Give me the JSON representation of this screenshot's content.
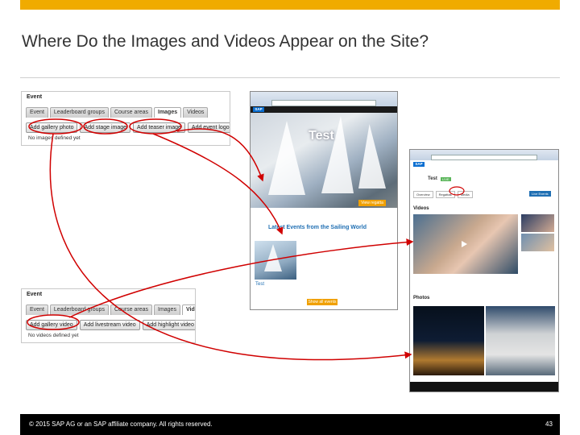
{
  "slide": {
    "title": "Where Do the Images and Videos Appear on the Site?",
    "footer_copyright": "© 2015 SAP AG or an SAP affiliate company. All rights reserved.",
    "page_number": "43",
    "accent_color": "#f0ab00",
    "arrow_color": "#d00000"
  },
  "editor_images": {
    "heading": "Event",
    "tabs": [
      "Event",
      "Leaderboard groups",
      "Course areas",
      "Images",
      "Videos"
    ],
    "selected_tab": "Images",
    "buttons": [
      "Add gallery photo",
      "Add stage image",
      "Add teaser image",
      "Add event logo"
    ],
    "empty_note": "No images defined yet"
  },
  "editor_videos": {
    "heading": "Event",
    "tabs": [
      "Event",
      "Leaderboard groups",
      "Course areas",
      "Images",
      "Videos"
    ],
    "selected_tab": "Videos",
    "buttons": [
      "Add gallery video",
      "Add livestream video",
      "Add highlight video"
    ],
    "empty_note": "No videos defined yet"
  },
  "site_home": {
    "logo": "SAP",
    "hero_title": "Test",
    "hero_button": "View regatta",
    "section_heading": "Latest Events from the Sailing World",
    "card_title": "Test",
    "more_button": "Show all events"
  },
  "site_event": {
    "logo": "SAP",
    "event_title": "Test",
    "live_badge": "LIVE",
    "tabs": [
      "Overview",
      "Regattas",
      "Media"
    ],
    "selected_tab": "Media",
    "action_button": "Live Events",
    "videos_heading": "Videos",
    "photos_heading": "Photos"
  },
  "icons": {
    "play": "play-icon",
    "facebook": "facebook-icon",
    "twitter": "twitter-icon"
  }
}
